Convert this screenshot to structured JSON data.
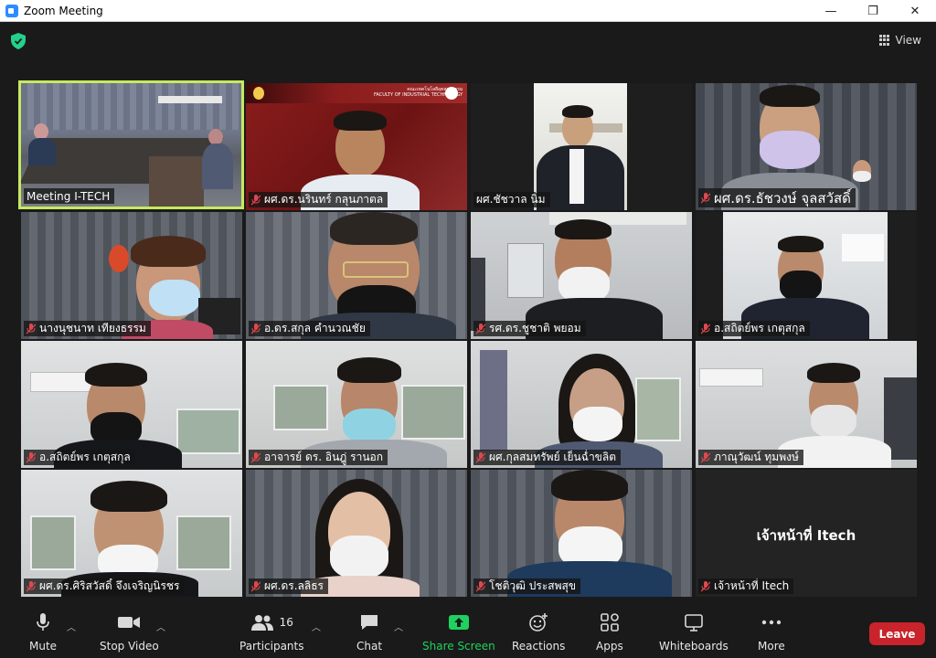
{
  "window": {
    "title": "Zoom Meeting",
    "minimize": "—",
    "maximize": "❐",
    "close": "✕"
  },
  "topbar": {
    "view_label": "View"
  },
  "tiles": [
    {
      "name": "Meeting I-TECH",
      "muted": false,
      "active": true
    },
    {
      "name": "ผศ.ดร.นรินทร์ กลุนภาตล",
      "muted": true
    },
    {
      "name": "ผศ.ชัชวาล นิ่ม",
      "muted": false
    },
    {
      "name": "ผศ.ดร.ธัชวงษ์ จุลสวัสดิ์",
      "muted": true
    },
    {
      "name": "นางนุชนาท เทียงธรรม",
      "muted": true
    },
    {
      "name": "อ.ดร.สกุล คำนวณชัย",
      "muted": true
    },
    {
      "name": "รศ.ดร.ชูชาติ พยอม",
      "muted": true
    },
    {
      "name": "อ.สถิตย์พร เกตุสกุล",
      "muted": true
    },
    {
      "name": "อ.สถิตย์พร เกตุสกุล",
      "muted": true
    },
    {
      "name": "อาจารย์ ดร. อินฎู่ รานอก",
      "muted": true
    },
    {
      "name": "ผศ.กุลสมทรัพย์ เย็นฉ่ำขลิต",
      "muted": true
    },
    {
      "name": "ภาณุวัฒน์ ทุมพงษ์",
      "muted": true
    },
    {
      "name": "ผศ.ดร.ศิริสวัสดิ์ จึงเจริญนิรชร",
      "muted": true
    },
    {
      "name": "ผศ.ดร.ลลิธร",
      "muted": true
    },
    {
      "name": "โชติวุฒิ ประสพสุข",
      "muted": true
    },
    {
      "name": "เจ้าหน้าที่ Itech",
      "muted": true
    }
  ],
  "tile2_banner": {
    "line1": "คณะเทคโนโลยีอุตสาหกรรม",
    "line2": "FACULTY OF INDUSTRIAL TECHNOLOGY"
  },
  "tile16_display_name": "เจ้าหน้าที่ Itech",
  "toolbar": {
    "mute": "Mute",
    "stop_video": "Stop Video",
    "participants": "Participants",
    "participants_count": "16",
    "chat": "Chat",
    "share_screen": "Share Screen",
    "reactions": "Reactions",
    "apps": "Apps",
    "whiteboards": "Whiteboards",
    "more": "More",
    "leave": "Leave"
  },
  "colors": {
    "active_border": "#c7e95e",
    "share": "#1fd160",
    "leave": "#c9242b",
    "shield": "#23d18b"
  }
}
